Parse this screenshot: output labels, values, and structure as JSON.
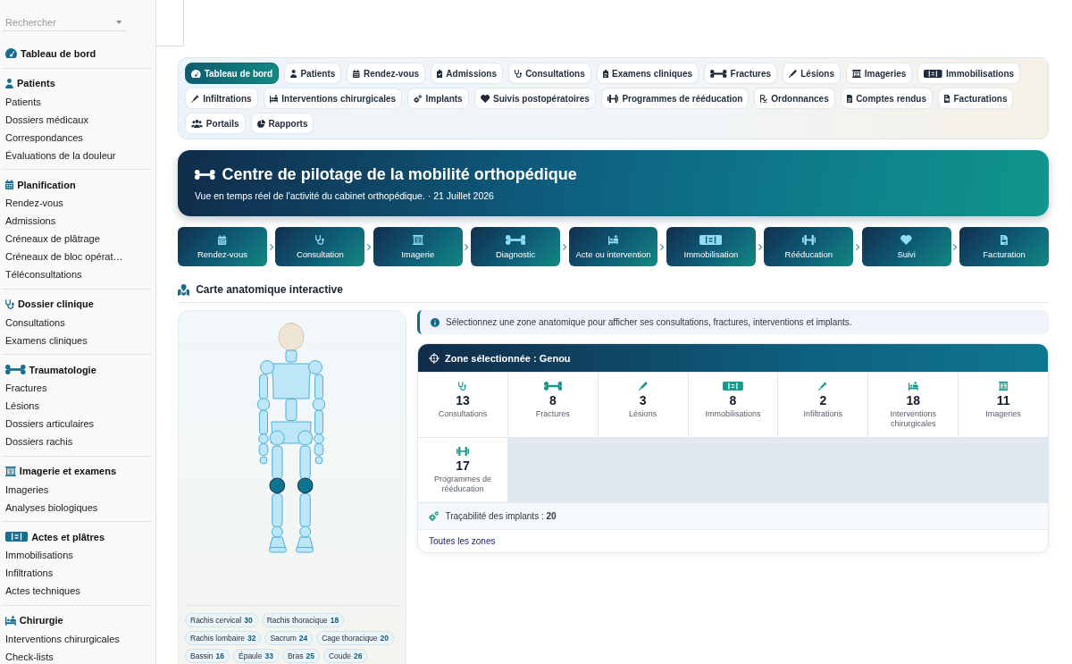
{
  "sidebar": {
    "search": {
      "placeholder": "Rechercher"
    },
    "sections": [
      {
        "title": "Tableau de bord"
      },
      {
        "title": "Patients",
        "items": [
          "Patients",
          "Dossiers médicaux",
          "Correspondances",
          "Évaluations de la douleur"
        ]
      },
      {
        "title": "Planification",
        "items": [
          "Rendez-vous",
          "Admissions",
          "Créneaux de plâtrage",
          "Créneaux de bloc opérat…",
          "Téléconsultations"
        ]
      },
      {
        "title": "Dossier clinique",
        "items": [
          "Consultations",
          "Examens cliniques"
        ]
      },
      {
        "title": "Traumatologie",
        "items": [
          "Fractures",
          "Lésions",
          "Dossiers articulaires",
          "Dossiers rachis"
        ]
      },
      {
        "title": "Imagerie et examens",
        "items": [
          "Imageries",
          "Analyses biologiques"
        ]
      },
      {
        "title": "Actes et plâtres",
        "items": [
          "Immobilisations",
          "Infiltrations",
          "Actes techniques"
        ]
      },
      {
        "title": "Chirurgie",
        "items": [
          "Interventions chirurgicales",
          "Check-lists"
        ]
      }
    ]
  },
  "nav_tabs": [
    {
      "label": "Tableau de bord",
      "selected": true
    },
    {
      "label": "Patients",
      "selected": false
    },
    {
      "label": "Rendez-vous",
      "selected": false
    },
    {
      "label": "Admissions",
      "selected": false
    },
    {
      "label": "Consultations",
      "selected": false
    },
    {
      "label": "Examens cliniques",
      "selected": false
    },
    {
      "label": "Fractures",
      "selected": false
    },
    {
      "label": "Lésions",
      "selected": false
    },
    {
      "label": "Imageries",
      "selected": false
    },
    {
      "label": "Immobilisations",
      "selected": false
    },
    {
      "label": "Infiltrations",
      "selected": false
    },
    {
      "label": "Interventions chirurgicales",
      "selected": false
    },
    {
      "label": "Implants",
      "selected": false
    },
    {
      "label": "Suivis postopératoires",
      "selected": false
    },
    {
      "label": "Programmes de rééducation",
      "selected": false
    },
    {
      "label": "Ordonnances",
      "selected": false
    },
    {
      "label": "Comptes rendus",
      "selected": false
    },
    {
      "label": "Facturations",
      "selected": false
    },
    {
      "label": "Portails",
      "selected": false
    },
    {
      "label": "Rapports",
      "selected": false
    }
  ],
  "banner": {
    "title": "Centre de pilotage de la mobilité orthopédique",
    "subtitle": "Vue en temps réel de l'activité du cabinet orthopédique. · 21 Juillet 2026"
  },
  "workflow": [
    "Rendez-vous",
    "Consultation",
    "Imagerie",
    "Diagnostic",
    "Acte ou intervention",
    "Immobilisation",
    "Rééducation",
    "Suivi",
    "Facturation"
  ],
  "anatomy": {
    "heading": "Carte anatomique interactive",
    "skeleton": [
      {
        "kind": "head",
        "selected": false
      },
      {
        "kind": "neck",
        "selected": false
      },
      {
        "kind": "shoulder",
        "selected": false
      },
      {
        "kind": "thorax",
        "selected": false
      },
      {
        "kind": "arm",
        "selected": false
      },
      {
        "kind": "elbow",
        "selected": false
      },
      {
        "kind": "spine",
        "selected": false
      },
      {
        "kind": "forearm",
        "selected": false
      },
      {
        "kind": "pelvis",
        "selected": false
      },
      {
        "kind": "hip",
        "selected": false
      },
      {
        "kind": "wrist",
        "selected": false
      },
      {
        "kind": "hand",
        "selected": false
      },
      {
        "kind": "thigh",
        "selected": false
      },
      {
        "kind": "knee",
        "selected": true
      },
      {
        "kind": "leg",
        "selected": false
      },
      {
        "kind": "ankle",
        "selected": false
      },
      {
        "kind": "foot",
        "selected": false
      }
    ],
    "zones": [
      {
        "label": "Rachis cervical",
        "count": "30"
      },
      {
        "label": "Rachis thoracique",
        "count": "18"
      },
      {
        "label": "Rachis lombaire",
        "count": "32"
      },
      {
        "label": "Sacrum",
        "count": "24"
      },
      {
        "label": "Cage thoracique",
        "count": "20"
      },
      {
        "label": "Bassin",
        "count": "16"
      },
      {
        "label": "Épaule",
        "count": "33"
      },
      {
        "label": "Bras",
        "count": "25"
      },
      {
        "label": "Coude",
        "count": "26"
      }
    ]
  },
  "zone_panel": {
    "info": "Sélectionnez une zone anatomique pour afficher ses consultations, fractures, interventions et implants.",
    "title": "Zone sélectionnée : Genou",
    "stats": [
      {
        "value": "13",
        "label": "Consultations"
      },
      {
        "value": "8",
        "label": "Fractures"
      },
      {
        "value": "3",
        "label": "Lésions"
      },
      {
        "value": "8",
        "label": "Immobilisations"
      },
      {
        "value": "2",
        "label": "Infiltrations"
      },
      {
        "value": "18",
        "label": "Interventions chirurgicales"
      },
      {
        "value": "11",
        "label": "Imageries"
      },
      {
        "value": "17",
        "label": "Programmes de rééducation"
      }
    ],
    "implants": "Traçabilité des implants : **20**",
    "link": "Toutes les zones"
  }
}
